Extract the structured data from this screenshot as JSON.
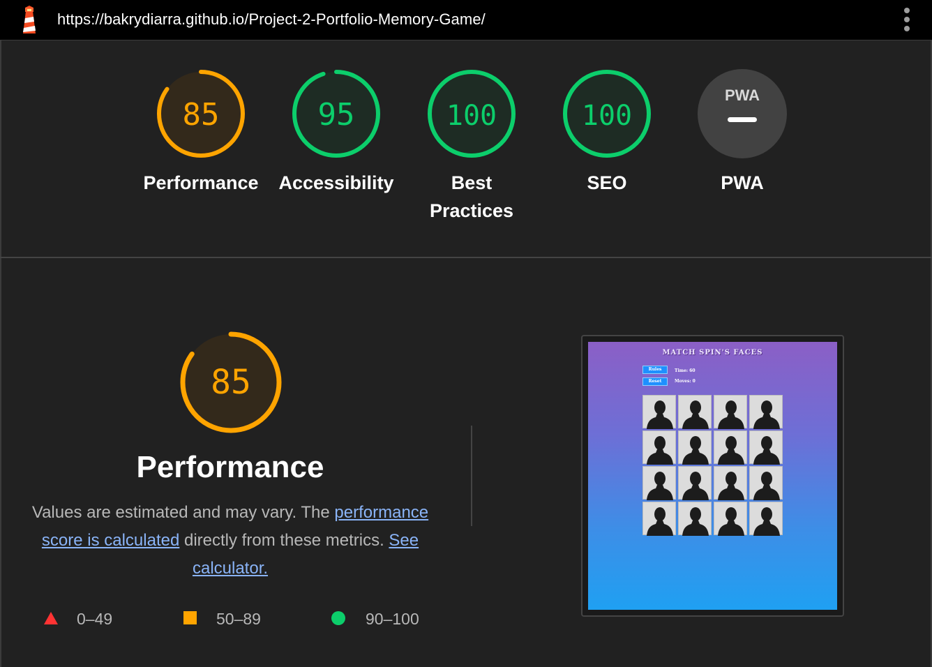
{
  "browser": {
    "url": "https://bakrydiarra.github.io/Project-2-Portfolio-Memory-Game/",
    "logo_icon": "lighthouse-icon",
    "menu_icon": "kebab-menu-icon"
  },
  "gauges": [
    {
      "score": "85",
      "label": "Performance",
      "fraction": 0.85,
      "status": "average"
    },
    {
      "score": "95",
      "label": "Accessibility",
      "fraction": 0.95,
      "status": "pass"
    },
    {
      "score": "100",
      "label": "Best Practices",
      "fraction": 1.0,
      "status": "pass"
    },
    {
      "score": "100",
      "label": "SEO",
      "fraction": 1.0,
      "status": "pass"
    },
    {
      "score": "",
      "label": "PWA",
      "badge": "PWA",
      "status": "na"
    }
  ],
  "performance": {
    "score": "85",
    "fraction": 0.85,
    "title": "Performance",
    "desc_text_1": "Values are estimated and may vary. The ",
    "desc_link_1": "performance score is calculated",
    "desc_text_2": " directly from these metrics. ",
    "desc_link_2": "See calculator."
  },
  "legend": [
    {
      "range": "0–49",
      "shape": "triangle",
      "color": "#ff3333"
    },
    {
      "range": "50–89",
      "shape": "square",
      "color": "#ffa400"
    },
    {
      "range": "90–100",
      "shape": "circle",
      "color": "#0cce6b"
    }
  ],
  "colors": {
    "average": "#ffa400",
    "pass": "#0cce6b",
    "average_bg": "#33291b",
    "pass_bg": "#1e2c24",
    "na_bg": "#424242"
  },
  "screenshot": {
    "title": "MATCH SPIN'S FACES",
    "rules_button": "Rules",
    "reset_button": "Reset",
    "time_text": "Time: 60",
    "moves_text": "Moves: 0",
    "card_count": 16,
    "card_icon": "person-silhouette-icon"
  }
}
